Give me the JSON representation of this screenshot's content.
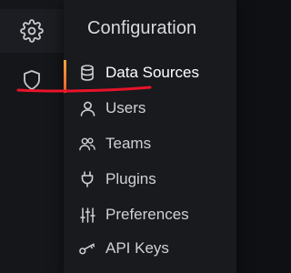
{
  "menu": {
    "title": "Configuration",
    "items": [
      {
        "label": "Data Sources",
        "icon": "database-icon"
      },
      {
        "label": "Users",
        "icon": "user-icon"
      },
      {
        "label": "Teams",
        "icon": "users-icon"
      },
      {
        "label": "Plugins",
        "icon": "plug-icon"
      },
      {
        "label": "Preferences",
        "icon": "sliders-icon"
      },
      {
        "label": "API Keys",
        "icon": "key-icon"
      }
    ]
  },
  "sidebar": {
    "items": [
      {
        "icon": "gear-icon"
      },
      {
        "icon": "shield-icon"
      }
    ]
  },
  "colors": {
    "background": "#0f1013",
    "menu_bg": "#181a1e",
    "text": "#d8d9da",
    "accent": "#f6a63c",
    "annotation": "#e8132a"
  }
}
